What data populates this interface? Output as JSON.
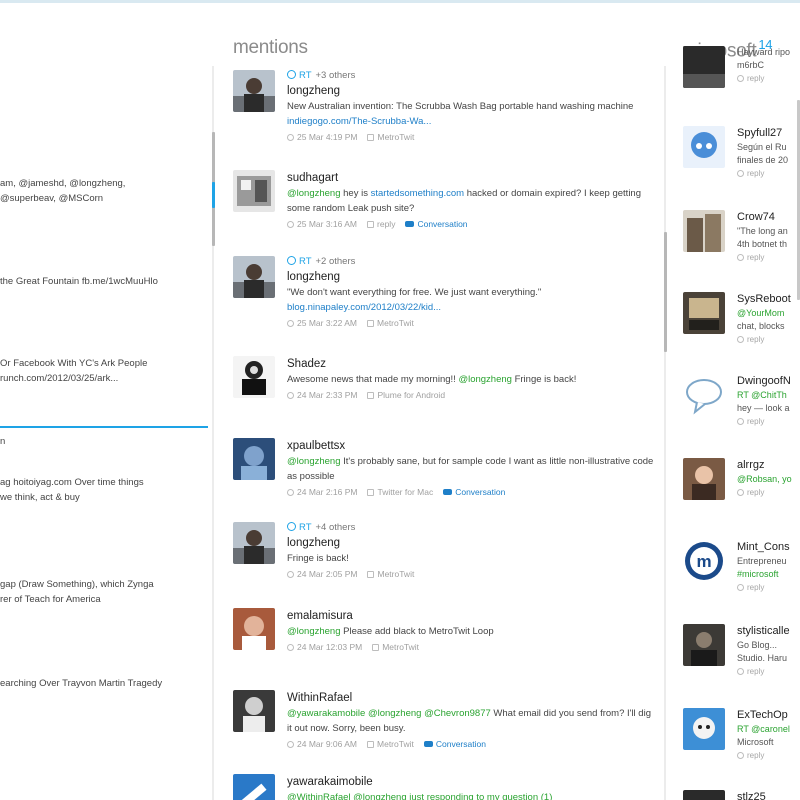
{
  "columns": {
    "mentions": {
      "title": "mentions"
    },
    "microsoft": {
      "title": "microsoft",
      "count": "14"
    }
  },
  "left_column": {
    "lines": [
      "am, @jameshd, @longzheng,",
      "@superbeav, @MSCorn",
      "the Great Fountain fb.me/1wcMuuHlo",
      "Or Facebook With YC's Ark People",
      "runch.com/2012/03/25/ark...",
      "n",
      "ag hoitoiyag.com Over time things",
      "we think, act & buy",
      "gap (Draw Something), which Zynga",
      "rer of Teach for America",
      "earching Over Trayvon Martin Tragedy"
    ]
  },
  "mentions": [
    {
      "retweet": {
        "tag": "RT",
        "count": "+3 others"
      },
      "author": "longzheng",
      "text": [
        {
          "t": "New Australian invention: The Scrubba Wash Bag portable hand washing machine ",
          "k": "plain"
        },
        {
          "t": "indiegogo.com/The-Scrubba-Wa...",
          "k": "link"
        }
      ],
      "time": "25 Mar 4:19 PM",
      "source": "MetroTwit",
      "reply": "",
      "conversation": "",
      "avatar": "avatar-person"
    },
    {
      "retweet": null,
      "author": "sudhagart",
      "text": [
        {
          "t": "@longzheng",
          "k": "mention"
        },
        {
          "t": " hey is ",
          "k": "plain"
        },
        {
          "t": "startedsomething.com",
          "k": "link"
        },
        {
          "t": " hacked or domain expired? I keep getting some random Leak push site?",
          "k": "plain"
        }
      ],
      "time": "25 Mar 3:16 AM",
      "source": "",
      "reply": "reply",
      "conversation": "Conversation",
      "avatar": "avatar-building"
    },
    {
      "retweet": {
        "tag": "RT",
        "count": "+2 others"
      },
      "author": "longzheng",
      "text": [
        {
          "t": "\"We don't want everything for free. We just want everything.\" ",
          "k": "plain"
        },
        {
          "t": "blog.ninapaley.com/2012/03/22/kid...",
          "k": "link"
        }
      ],
      "time": "25 Mar 3:22 AM",
      "source": "MetroTwit",
      "reply": "",
      "conversation": "",
      "avatar": "avatar-person"
    },
    {
      "retweet": null,
      "author": "Shadez",
      "text": [
        {
          "t": "Awesome news that made my morning!! ",
          "k": "plain"
        },
        {
          "t": "@longzheng",
          "k": "mention"
        },
        {
          "t": " Fringe is back!",
          "k": "plain"
        }
      ],
      "time": "24 Mar 2:33 PM",
      "source": "Plume for Android",
      "reply": "",
      "conversation": "",
      "avatar": "avatar-camera"
    },
    {
      "retweet": null,
      "author": "xpaulbettsx",
      "text": [
        {
          "t": "@longzheng",
          "k": "mention"
        },
        {
          "t": " It's probably sane, but for sample code I want as little non-illustrative code as possible",
          "k": "plain"
        }
      ],
      "time": "24 Mar 2:16 PM",
      "source": "Twitter for Mac",
      "reply": "",
      "conversation": "Conversation",
      "avatar": "avatar-blue"
    },
    {
      "retweet": {
        "tag": "RT",
        "count": "+4 others"
      },
      "author": "longzheng",
      "text": [
        {
          "t": "Fringe is back!",
          "k": "plain"
        }
      ],
      "time": "24 Mar 2:05 PM",
      "source": "MetroTwit",
      "reply": "",
      "conversation": "",
      "avatar": "avatar-person"
    },
    {
      "retweet": null,
      "author": "emalamisura",
      "text": [
        {
          "t": "@longzheng",
          "k": "mention"
        },
        {
          "t": " Please add black to MetroTwit Loop",
          "k": "plain"
        }
      ],
      "time": "24 Mar 12:03 PM",
      "source": "MetroTwit",
      "reply": "",
      "conversation": "",
      "avatar": "avatar-face"
    },
    {
      "retweet": null,
      "author": "WithinRafael",
      "text": [
        {
          "t": "@yawarakamobile",
          "k": "mention"
        },
        {
          "t": " ",
          "k": "plain"
        },
        {
          "t": "@longzheng",
          "k": "mention"
        },
        {
          "t": " ",
          "k": "plain"
        },
        {
          "t": "@Chevron9877",
          "k": "mention"
        },
        {
          "t": " What email did you send from? I'll dig it out now. Sorry, been busy.",
          "k": "plain"
        }
      ],
      "time": "24 Mar 9:06 AM",
      "source": "MetroTwit",
      "reply": "",
      "conversation": "Conversation",
      "avatar": "avatar-bw"
    },
    {
      "retweet": null,
      "author": "yawarakaimobile",
      "text": [
        {
          "t": "@WithinRafael @longzheng just responding to my question (1)",
          "k": "mention"
        }
      ],
      "time": "",
      "source": "",
      "reply": "",
      "conversation": "",
      "avatar": "avatar-wrench"
    }
  ],
  "microsoft": [
    {
      "name": "",
      "lines": [
        "Hayward ripo",
        "m6rbC"
      ],
      "meta": "reply",
      "avatar": "avatar-dark"
    },
    {
      "name": "Spyfull27",
      "lines": [
        "Según el Ru",
        "finales de 20"
      ],
      "meta": "reply",
      "avatar": "avatar-anime"
    },
    {
      "name": "Crow74",
      "lines": [
        "\"The long an",
        "4th botnet th"
      ],
      "meta": "reply",
      "avatar": "avatar-bldg2"
    },
    {
      "name": "SysReboot",
      "lines": [
        "@YourMom",
        "chat, blocks"
      ],
      "meta": "reply",
      "avatar": "avatar-room"
    },
    {
      "name": "DwingoofN",
      "lines": [
        "RT @ChitTh",
        "hey — look a"
      ],
      "meta": "reply",
      "avatar": "avatar-bubble"
    },
    {
      "name": "alrrgz",
      "lines": [
        "@Robsan, yo"
      ],
      "meta": "reply",
      "avatar": "avatar-girl"
    },
    {
      "name": "Mint_Cons",
      "lines": [
        "Entrepreneu",
        "#microsoft"
      ],
      "meta": "reply",
      "avatar": "avatar-m"
    },
    {
      "name": "stylisticalle",
      "lines": [
        "Go Blog...",
        "Studio. Haru"
      ],
      "meta": "reply",
      "avatar": "avatar-dark2"
    },
    {
      "name": "ExTechOp",
      "lines": [
        "RT @caronel",
        "Microsoft"
      ],
      "meta": "reply",
      "avatar": "avatar-dog"
    },
    {
      "name": "stlz25",
      "lines": [],
      "meta": "",
      "avatar": "avatar-dark"
    }
  ]
}
